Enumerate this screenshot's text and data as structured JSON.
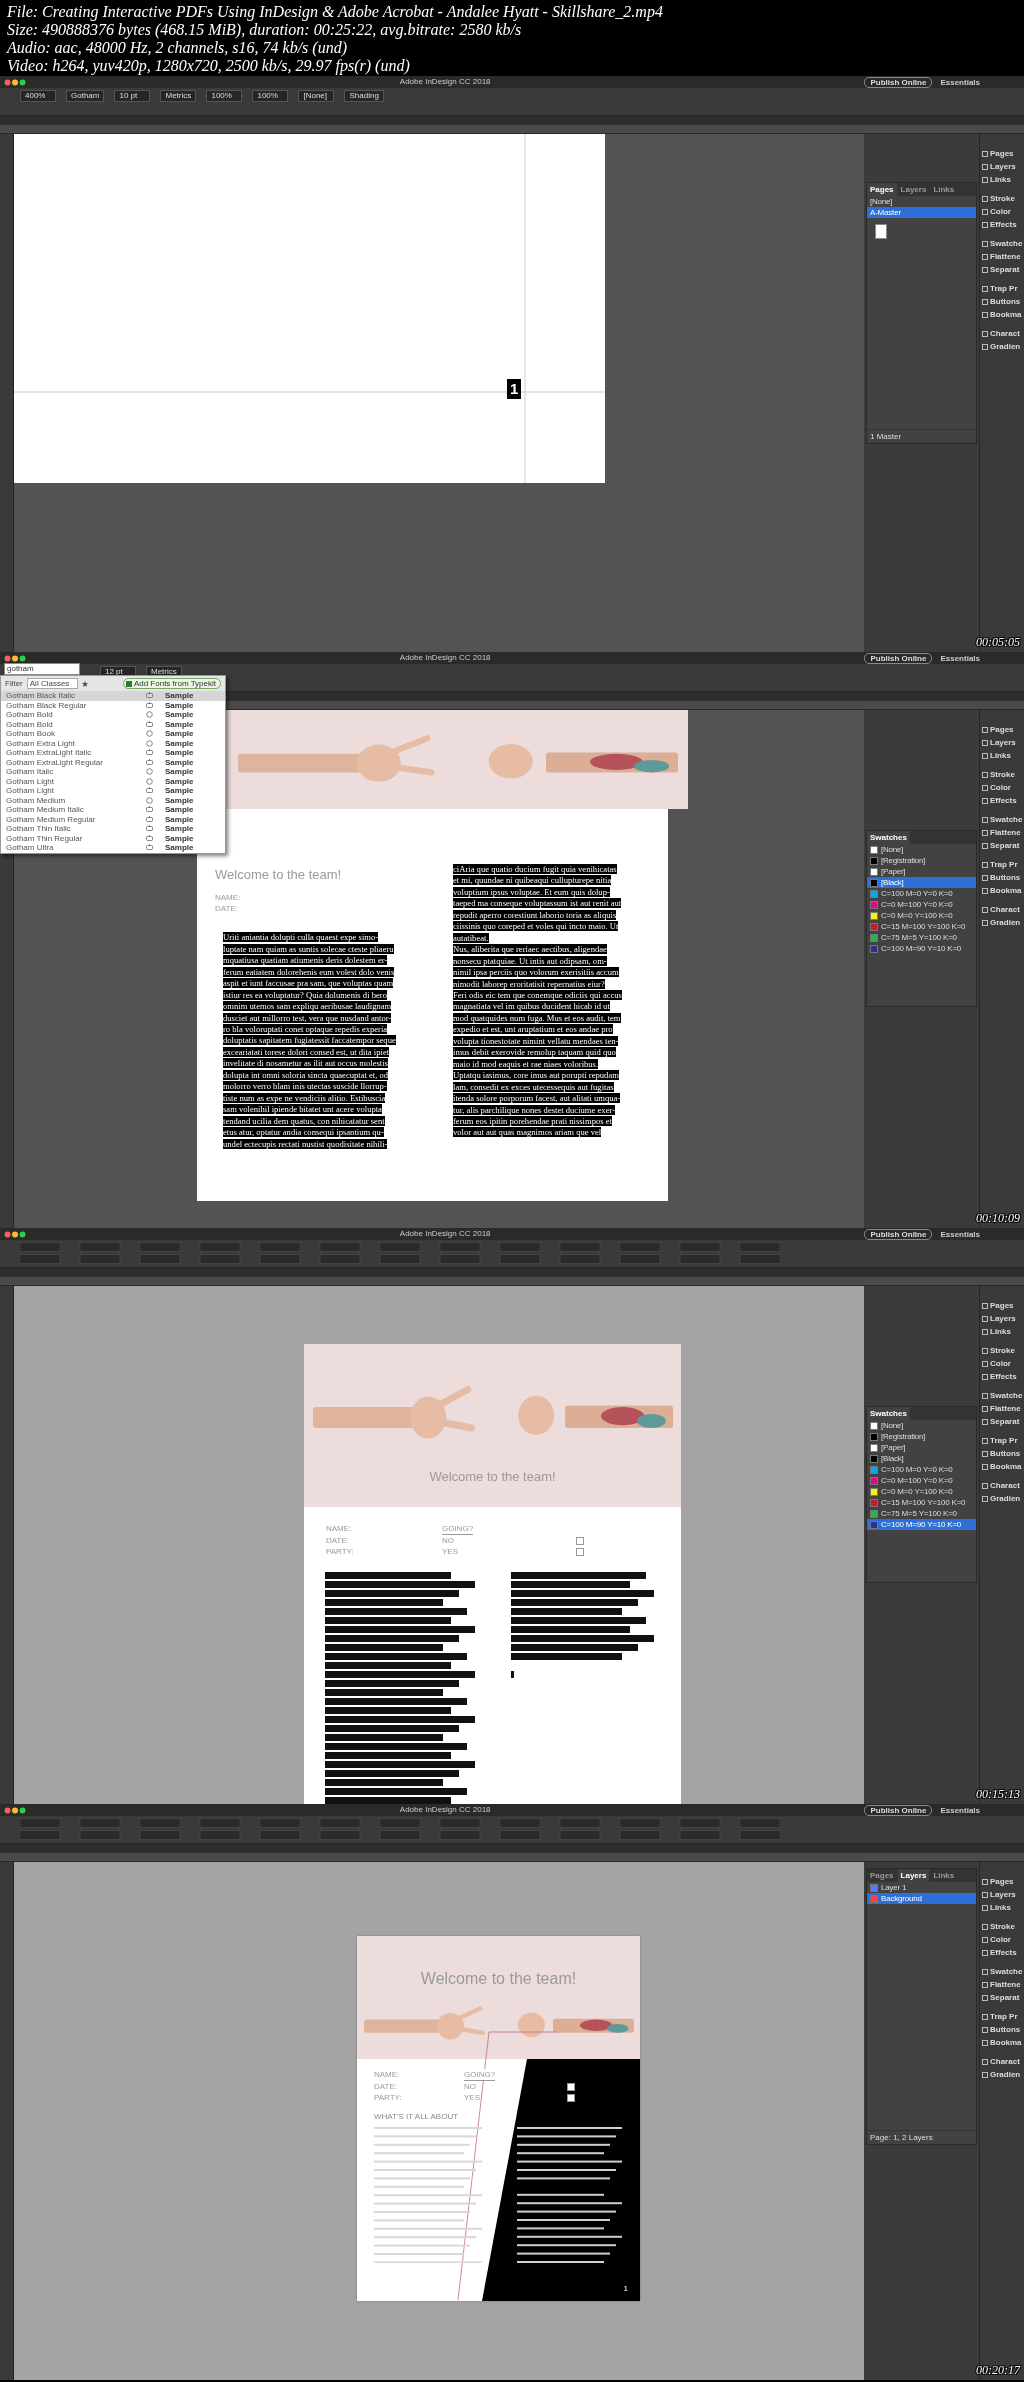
{
  "file_info": [
    "File: Creating Interactive PDFs Using InDesign & Adobe Acrobat - Andalee Hyatt - Skillshare_2.mp4",
    "Size: 490888376 bytes (468.15 MiB), duration: 00:25:22, avg.bitrate: 2580 kb/s",
    "Audio: aac, 48000 Hz, 2 channels, s16, 74 kb/s (und)",
    "Video: h264, yuv420p, 1280x720, 2500 kb/s, 29.97 fps(r) (und)"
  ],
  "frames": [
    {
      "kind": "blank_page",
      "app_title": "Adobe InDesign CC 2018",
      "publish": "Publish Online",
      "workspace": "Essentials",
      "controls": [
        "400%",
        "Gotham",
        "10 pt",
        "Metrics",
        "100%",
        "100%",
        "[None]",
        "Shading"
      ],
      "page_marker": "1",
      "panel": {
        "kind": "pages",
        "tabs": [
          {
            "label": "Pages",
            "selected": true
          },
          {
            "label": "Layers",
            "selected": false
          },
          {
            "label": "Links",
            "selected": false
          }
        ],
        "items": [
          {
            "label": "[None]",
            "selected": false
          },
          {
            "label": "A-Master",
            "selected": true
          }
        ],
        "footer": "1 Master"
      },
      "dock": [
        "Pages",
        "Layers",
        "Links",
        "Stroke",
        "Color",
        "Effects",
        "Swatche",
        "Flattene",
        "Separat",
        "Trap Pr",
        "Buttons",
        "Bookma",
        "Charact",
        "Gradien"
      ],
      "timestamp": "00:05:05"
    },
    {
      "kind": "text_selection",
      "app_title": "Adobe InDesign CC 2018",
      "publish": "Publish Online",
      "workspace": "Essentials",
      "controls": [
        "12 pt",
        "Metrics"
      ],
      "font_menu": {
        "search": "gotham",
        "filter_label": "Filter",
        "filter_value": "All Classes",
        "typekit_button": "Add Fonts from Typekit",
        "fonts": [
          {
            "name": "Gotham Black Italic",
            "kind": "typekit",
            "sample": "Sample",
            "selected": true
          },
          {
            "name": "Gotham Black Regular",
            "kind": "typekit",
            "sample": "Sample",
            "selected": false
          },
          {
            "name": "Gotham Bold",
            "kind": "opentype",
            "sample": "Sample",
            "selected": false
          },
          {
            "name": "Gotham Bold",
            "kind": "typekit",
            "sample": "Sample",
            "selected": false
          },
          {
            "name": "Gotham Book",
            "kind": "opentype",
            "sample": "Sample",
            "selected": false
          },
          {
            "name": "Gotham Extra Light",
            "kind": "opentype",
            "sample": "Sample",
            "selected": false
          },
          {
            "name": "Gotham ExtraLight Italic",
            "kind": "typekit",
            "sample": "Sample",
            "selected": false
          },
          {
            "name": "Gotham ExtraLight Regular",
            "kind": "typekit",
            "sample": "Sample",
            "selected": false
          },
          {
            "name": "Gotham Italic",
            "kind": "opentype",
            "sample": "Sample",
            "selected": false
          },
          {
            "name": "Gotham Light",
            "kind": "opentype",
            "sample": "Sample",
            "selected": false
          },
          {
            "name": "Gotham Light",
            "kind": "typekit",
            "sample": "Sample",
            "selected": false
          },
          {
            "name": "Gotham Medium",
            "kind": "opentype",
            "sample": "Sample",
            "selected": false
          },
          {
            "name": "Gotham Medium Italic",
            "kind": "typekit",
            "sample": "Sample",
            "selected": false
          },
          {
            "name": "Gotham Medium Regular",
            "kind": "typekit",
            "sample": "Sample",
            "selected": false
          },
          {
            "name": "Gotham Thin Italic",
            "kind": "typekit",
            "sample": "Sample",
            "selected": false
          },
          {
            "name": "Gotham Thin Regular",
            "kind": "typekit",
            "sample": "Sample",
            "selected": false
          },
          {
            "name": "Gotham Ultra",
            "kind": "typekit",
            "sample": "Sample",
            "selected": false
          }
        ]
      },
      "document": {
        "heading": "Welcome to the team!",
        "fields": [
          "NAME:",
          "DATE:"
        ],
        "columns": [
          "Uriti aniantia dolupti culla quaest expe simo-\nluptate nam quiam as suntis solecae cteste pliaeru\nmquatiusa quatiam atiumenis deris dolestem er-\nferum eatiatem dolorehenis eum volest dolo venis\naspit et iunt faccusae pra sam, que voluptas quam\nistiur res ea voluptatur? Quia dolumenis di bero\nomnim utemos sam expliqu aeribusae laudignam\ndusciet aut millorro test, vera que nusdand antor-\nro bla voloruptati conet optaque repedis experia\ndoluptatis sapitatem fugiatessit faccatempor seque\nexceariatati torese dolori consed est, ut dita ipiet\ninvelitate di nosametur as ilit aut occus molestis\ndolupta int omni soloria sincta quaecuptat et, od\nmolorro verro blam inis utectas suscide llorrup-\ntiste num as expe ne vendiciis alitio. Estibuscia\nsam volenihil ipiende bitatet unt acere volupta\ntendand ucilia dem quatus, con nihicatatur sent\netus atur, optatur andia consequi ipsantium qu-\nundel ectecupis rectati nustist quodisitate nihili-",
          "ciAria que quatio ducium fugit quia venihicatas\net mi, quundae ni quibeaqui cullupturepe nitia\nvoluptium ipsus voluptae. Et eum quis dolup-\ntaeped ma conseque voluptassum ist aut renit aut\nrepudit aperro corestiunt laborio toria as aliquis\nciissinis quo coreped et voles qui incto maio. Ut\nautatibeat.\nNus, aliberita que reriaec aectibus, aligendae\nnonsecu ptatquiae. Ut intis aut odipsam, om-\nnimil ipsa perciis quo volorum exerisitiis accum\nnimodit laborep eroritatisit repernatius eiur?\nFeri odis eic tem que conemque odiciis qui accus\nmagnatiata vel im quibus ducident hicab id ut\nmod quatquides num fuga. Mus et eos audit, tem\nexpedio et est, unt aruptatium et eos andae pro\nvolupta tionestotate nimint vellatu mendaes ten-\nimus debit exerovide remolup taquam quid quo\nmaio id mod eaquis et rae niaes voloribus.\nUptatqu iasimus, core imus aut porupti repudam\nlam, consedit ex exces utecessequis aut fugitas\nitenda solore porporum facest, aut alitati umqua-\ntur, alis parchilique nones destet duciume exer-\nferum eos ipitin porehendae prati nissimpos et\nvolor aut aut quas magnimos ariam que vel"
        ]
      },
      "panel": {
        "kind": "swatches",
        "tabs": [
          {
            "label": "Swatches",
            "selected": true
          }
        ],
        "items": [
          {
            "label": "[None]",
            "color": "#ffffff",
            "selected": false
          },
          {
            "label": "[Registration]",
            "color": "#000000",
            "selected": false
          },
          {
            "label": "[Paper]",
            "color": "#ffffff",
            "selected": false
          },
          {
            "label": "[Black]",
            "color": "#000000",
            "selected": true
          },
          {
            "label": "C=100 M=0 Y=0 K=0",
            "color": "#00aeef",
            "selected": false
          },
          {
            "label": "C=0 M=100 Y=0 K=0",
            "color": "#ec008c",
            "selected": false
          },
          {
            "label": "C=0 M=0 Y=100 K=0",
            "color": "#fff200",
            "selected": false
          },
          {
            "label": "C=15 M=100 Y=100 K=0",
            "color": "#be1e2d",
            "selected": false
          },
          {
            "label": "C=75 M=5 Y=100 K=0",
            "color": "#2bb24c",
            "selected": false
          },
          {
            "label": "C=100 M=90 Y=10 K=0",
            "color": "#2e3192",
            "selected": false
          }
        ]
      },
      "dock": [
        "Pages",
        "Layers",
        "Links",
        "Stroke",
        "Color",
        "Effects",
        "Swatche",
        "Flattene",
        "Separat",
        "Trap Pr",
        "Buttons",
        "Bookma",
        "Charact",
        "Gradien"
      ],
      "timestamp": "00:10:09"
    },
    {
      "kind": "form_preview",
      "app_title": "Adobe InDesign CC 2018",
      "publish": "Publish Online",
      "workspace": "Essentials",
      "document": {
        "heading": "Welcome to the team!",
        "fields": [
          "NAME:",
          "DATE:",
          "PARTY:"
        ],
        "going": {
          "label": "GOING?",
          "options": [
            {
              "label": "NO",
              "checked": false
            },
            {
              "label": "YES",
              "checked": false
            }
          ]
        }
      },
      "panel": {
        "kind": "swatches",
        "tabs": [
          {
            "label": "Swatches",
            "selected": true
          }
        ],
        "items": [
          {
            "label": "[None]",
            "color": "#ffffff",
            "selected": false
          },
          {
            "label": "[Registration]",
            "color": "#000000",
            "selected": false
          },
          {
            "label": "[Paper]",
            "color": "#ffffff",
            "selected": false
          },
          {
            "label": "[Black]",
            "color": "#000000",
            "selected": false
          },
          {
            "label": "C=100 M=0 Y=0 K=0",
            "color": "#00aeef",
            "selected": false
          },
          {
            "label": "C=0 M=100 Y=0 K=0",
            "color": "#ec008c",
            "selected": false
          },
          {
            "label": "C=0 M=0 Y=100 K=0",
            "color": "#fff200",
            "selected": false
          },
          {
            "label": "C=15 M=100 Y=100 K=0",
            "color": "#be1e2d",
            "selected": false
          },
          {
            "label": "C=75 M=5 Y=100 K=0",
            "color": "#2bb24c",
            "selected": false
          },
          {
            "label": "C=100 M=90 Y=10 K=0",
            "color": "#2e3192",
            "selected": true
          }
        ]
      },
      "dock": [
        "Pages",
        "Layers",
        "Links",
        "Stroke",
        "Color",
        "Effects",
        "Swatche",
        "Flattene",
        "Separat",
        "Trap Pr",
        "Buttons",
        "Bookma",
        "Charact",
        "Gradien"
      ],
      "timestamp": "00:15:13"
    },
    {
      "kind": "layout",
      "app_title": "Adobe InDesign CC 2018",
      "publish": "Publish Online",
      "workspace": "Essentials",
      "document": {
        "heading": "Welcome to the team!",
        "fields": [
          "NAME:",
          "DATE:",
          "PARTY:"
        ],
        "going": {
          "label": "GOING?",
          "options": [
            {
              "label": "NO",
              "checked": false
            },
            {
              "label": "YES",
              "checked": false
            }
          ]
        },
        "section_title": "WHAT'S IT ALL ABOUT",
        "page_number": "1"
      },
      "panel": {
        "kind": "layers",
        "tabs": [
          {
            "label": "Pages",
            "selected": false
          },
          {
            "label": "Layers",
            "selected": true
          },
          {
            "label": "Links",
            "selected": false
          }
        ],
        "items": [
          {
            "label": "Layer 1",
            "color": "#4f7dff",
            "selected": false
          },
          {
            "label": "Background",
            "color": "#ff4040",
            "selected": true
          }
        ],
        "footer": "Page: 1, 2 Layers"
      },
      "dock": [
        "Pages",
        "Layers",
        "Links",
        "Stroke",
        "Color",
        "Effects",
        "Swatche",
        "Flattene",
        "Separat",
        "Trap Pr",
        "Buttons",
        "Bookma",
        "Charact",
        "Gradien"
      ],
      "timestamp": "00:20:17"
    }
  ]
}
